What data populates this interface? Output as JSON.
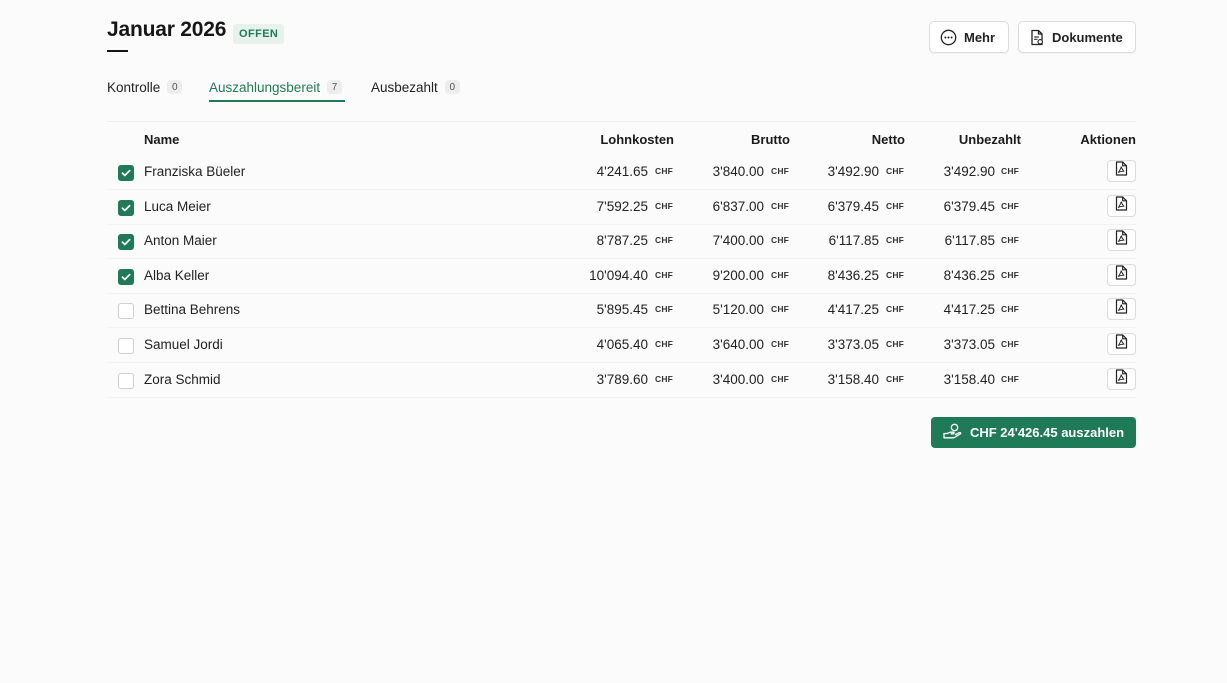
{
  "header": {
    "title": "Januar 2026",
    "status": "OFFEN",
    "more_label": "Mehr",
    "documents_label": "Dokumente"
  },
  "tabs": [
    {
      "label": "Kontrolle",
      "count": "0",
      "active": false
    },
    {
      "label": "Auszahlungsbereit",
      "count": "7",
      "active": true
    },
    {
      "label": "Ausbezahlt",
      "count": "0",
      "active": false
    }
  ],
  "table": {
    "columns": {
      "name": "Name",
      "lohnkosten": "Lohnkosten",
      "brutto": "Brutto",
      "netto": "Netto",
      "unbezahlt": "Unbezahlt",
      "aktionen": "Aktionen"
    },
    "currency": "CHF",
    "rows": [
      {
        "checked": true,
        "name": "Franziska Büeler",
        "lohnkosten": "4'241.65",
        "brutto": "3'840.00",
        "netto": "3'492.90",
        "unbezahlt": "3'492.90"
      },
      {
        "checked": true,
        "name": "Luca Meier",
        "lohnkosten": "7'592.25",
        "brutto": "6'837.00",
        "netto": "6'379.45",
        "unbezahlt": "6'379.45"
      },
      {
        "checked": true,
        "name": "Anton Maier",
        "lohnkosten": "8'787.25",
        "brutto": "7'400.00",
        "netto": "6'117.85",
        "unbezahlt": "6'117.85"
      },
      {
        "checked": true,
        "name": "Alba Keller",
        "lohnkosten": "10'094.40",
        "brutto": "9'200.00",
        "netto": "8'436.25",
        "unbezahlt": "8'436.25"
      },
      {
        "checked": false,
        "name": "Bettina Behrens",
        "lohnkosten": "5'895.45",
        "brutto": "5'120.00",
        "netto": "4'417.25",
        "unbezahlt": "4'417.25"
      },
      {
        "checked": false,
        "name": "Samuel Jordi",
        "lohnkosten": "4'065.40",
        "brutto": "3'640.00",
        "netto": "3'373.05",
        "unbezahlt": "3'373.05"
      },
      {
        "checked": false,
        "name": "Zora Schmid",
        "lohnkosten": "3'789.60",
        "brutto": "3'400.00",
        "netto": "3'158.40",
        "unbezahlt": "3'158.40"
      }
    ]
  },
  "pay_button": {
    "label": "CHF 24'426.45 auszahlen"
  },
  "colors": {
    "accent": "#1f7a57",
    "badge_bg": "#e8f2ec"
  },
  "icons": {
    "more": "ellipsis-circle-icon",
    "documents": "document-icon",
    "pdf": "pdf-file-icon",
    "pay": "hand-money-icon"
  }
}
